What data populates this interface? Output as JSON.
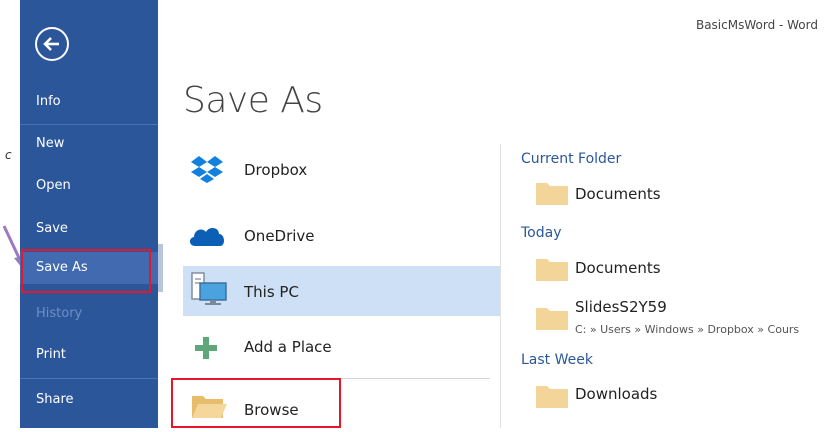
{
  "window": {
    "title": "BasicMsWord  -  Word"
  },
  "backstage": {
    "back_label": "",
    "nav": [
      {
        "label": "Info"
      },
      {
        "label": "New"
      },
      {
        "label": "Open"
      },
      {
        "label": "Save"
      },
      {
        "label": "Save As"
      },
      {
        "label": "History"
      },
      {
        "label": "Print"
      },
      {
        "label": "Share"
      }
    ],
    "active_item": "Save As",
    "disabled_item": "History"
  },
  "page": {
    "title": "Save As"
  },
  "places": [
    {
      "label": "Dropbox",
      "icon": "dropbox-icon"
    },
    {
      "label": "OneDrive",
      "icon": "onedrive-cloud-icon"
    },
    {
      "label": "This PC",
      "icon": "computer-icon",
      "selected": true
    },
    {
      "label": "Add a Place",
      "icon": "plus-icon"
    },
    {
      "label": "Browse",
      "icon": "folder-open-icon"
    }
  ],
  "recent": {
    "groups": [
      {
        "heading": "Current Folder",
        "folders": [
          {
            "name": "Documents"
          }
        ]
      },
      {
        "heading": "Today",
        "folders": [
          {
            "name": "Documents"
          },
          {
            "name": "SlidesS2Y59",
            "path": "C: » Users » Windows » Dropbox » Cours"
          }
        ]
      },
      {
        "heading": "Last Week",
        "folders": [
          {
            "name": "Downloads"
          }
        ]
      }
    ]
  },
  "annotation": {
    "margin_mark": "c"
  },
  "colors": {
    "sidebar": "#2b579a",
    "sidebar_active": "#416ab0",
    "accent_text": "#2b579a",
    "selected_place": "#cde0f5",
    "annotation_red": "#e6172b",
    "annotation_arrow": "#9b7ac0",
    "folder": "#f3d59a"
  }
}
